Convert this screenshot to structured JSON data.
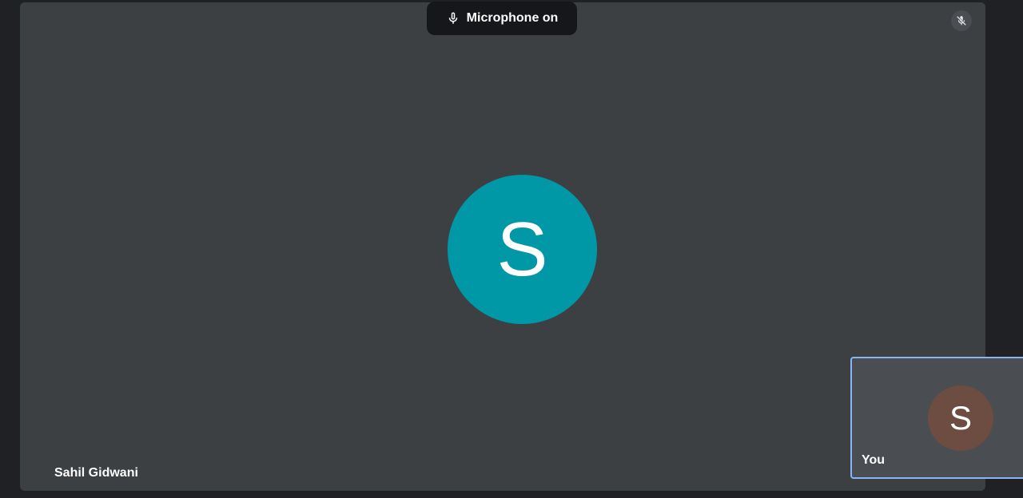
{
  "toast": {
    "text": "Microphone on",
    "icon": "microphone-icon"
  },
  "main_participant": {
    "name": "Sahil Gidwani",
    "initial": "S",
    "avatar_color": "#0097a7",
    "muted_icon": "microphone-off-icon"
  },
  "self_participant": {
    "name": "You",
    "initial": "S",
    "avatar_color": "#6d4c41",
    "highlight_color": "#8ab4f8"
  },
  "colors": {
    "background": "#202124",
    "tile": "#3c4043",
    "self_tile": "#4a4d51",
    "toast": "#16171a"
  }
}
